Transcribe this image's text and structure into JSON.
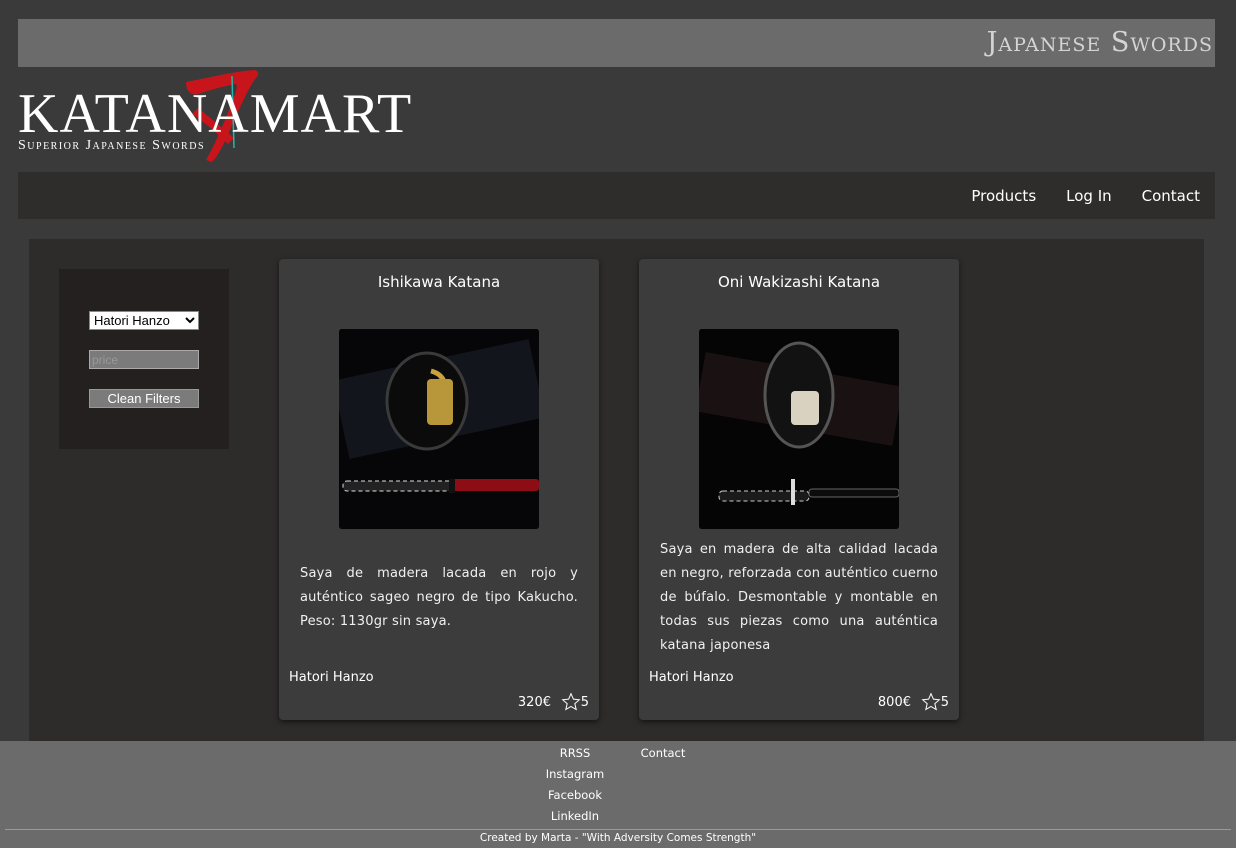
{
  "header": {
    "tagline": "Japanese Swords",
    "logo_word": "KATANAMART",
    "logo_sub": "Superior Japanese Swords"
  },
  "nav": {
    "products": "Products",
    "login": "Log In",
    "contact": "Contact"
  },
  "filters": {
    "maker_selected": "Hatori Hanzo",
    "price_placeholder": "price",
    "clean_label": "Clean Filters"
  },
  "products": [
    {
      "title": "Ishikawa Katana",
      "description": "Saya de madera lacada en rojo y auténtico sageo negro de tipo Kakucho. Peso: 1130gr sin saya.",
      "maker": "Hatori Hanzo",
      "price": "320€",
      "rating": "5"
    },
    {
      "title": "Oni Wakizashi Katana",
      "description": "Saya en madera de alta calidad lacada en negro, reforzada con auténtico cuerno de búfalo. Desmontable y montable en todas sus piezas como una auténtica katana japonesa",
      "maker": "Hatori Hanzo",
      "price": "800€",
      "rating": "5"
    }
  ],
  "footer": {
    "rrss": "RRSS",
    "instagram": "Instagram",
    "facebook": "Facebook",
    "linkedin": "LinkedIn",
    "contact": "Contact",
    "credit": "Created by Marta - \"With Adversity Comes Strength\""
  },
  "colors": {
    "brand_red": "#c8151b",
    "background": "#3a3a3a",
    "panel": "#2e2c2b"
  }
}
